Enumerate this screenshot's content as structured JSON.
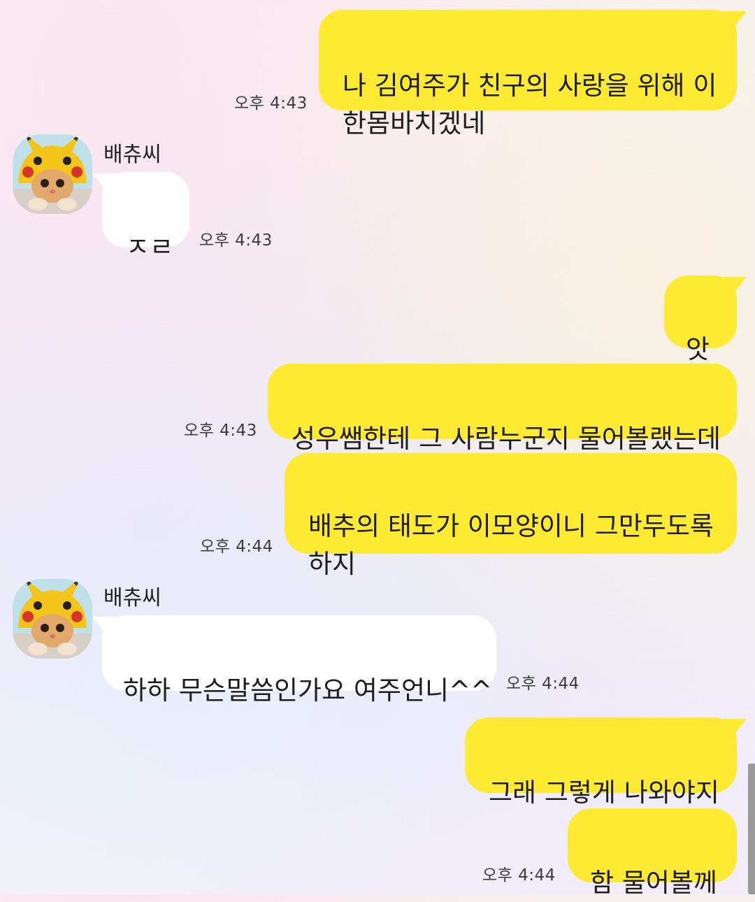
{
  "chat": {
    "contact_name": "배츄씨",
    "messages": [
      {
        "from": "me",
        "text": "나 김여주가 친구의 사랑을 위해 이\n한몸바치겠네",
        "time": "오후 4:43"
      },
      {
        "from": "them",
        "text": "ㅈㄹ",
        "time": "오후 4:43"
      },
      {
        "from": "me",
        "text": "앗",
        "time": ""
      },
      {
        "from": "me",
        "text": "성우쌤한테 그 사람누군지 물어볼랬는데",
        "time": "오후 4:43"
      },
      {
        "from": "me",
        "text": "배추의 태도가 이모양이니 그만두도록\n하지",
        "time": "오후 4:44"
      },
      {
        "from": "them",
        "text": "하하 무슨말씀인가요 여주언니^^",
        "time": "오후 4:44"
      },
      {
        "from": "me",
        "text": "그래 그렇게 나와야지",
        "time": ""
      },
      {
        "from": "me",
        "text": "함 물어볼께",
        "time": "오후 4:44"
      }
    ]
  },
  "colors": {
    "my_bubble": "#fee933",
    "their_bubble": "#ffffff",
    "text": "#1d1d1d"
  },
  "icons": {
    "avatar": "pikachu-hat-cat-avatar"
  }
}
